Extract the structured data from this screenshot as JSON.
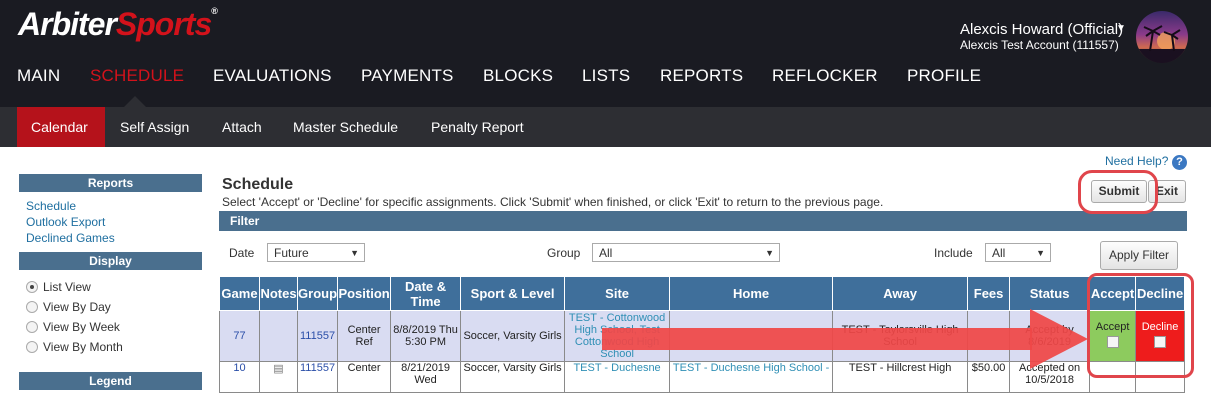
{
  "brand": {
    "name_part1": "Arbiter",
    "name_part2": "Sports",
    "tm": "®"
  },
  "user": {
    "name": "Alexcis Howard (Official)",
    "account": "Alexcis Test Account (111557)"
  },
  "main_nav": [
    {
      "label": "MAIN"
    },
    {
      "label": "SCHEDULE"
    },
    {
      "label": "EVALUATIONS"
    },
    {
      "label": "PAYMENTS"
    },
    {
      "label": "BLOCKS"
    },
    {
      "label": "LISTS"
    },
    {
      "label": "REPORTS"
    },
    {
      "label": "REFLOCKER"
    },
    {
      "label": "PROFILE"
    }
  ],
  "sub_nav": [
    {
      "label": "Calendar"
    },
    {
      "label": "Self Assign"
    },
    {
      "label": "Attach"
    },
    {
      "label": "Master Schedule"
    },
    {
      "label": "Penalty Report"
    }
  ],
  "sidebar": {
    "reports_header": "Reports",
    "report_links": [
      "Schedule",
      "Outlook Export",
      "Declined Games"
    ],
    "display_header": "Display",
    "display_options": [
      {
        "label": "List View",
        "selected": true
      },
      {
        "label": "View By Day",
        "selected": false
      },
      {
        "label": "View By Week",
        "selected": false
      },
      {
        "label": "View By Month",
        "selected": false
      }
    ],
    "legend_header": "Legend"
  },
  "help": {
    "label": "Need Help?",
    "icon": "?"
  },
  "page": {
    "title": "Schedule",
    "instruction": "Select 'Accept' or 'Decline' for specific assignments. Click 'Submit' when finished, or click 'Exit' to return to the previous page.",
    "submit_label": "Submit",
    "exit_label": "Exit"
  },
  "filter": {
    "header": "Filter",
    "date_label": "Date",
    "date_value": "Future",
    "group_label": "Group",
    "group_value": "All",
    "include_label": "Include",
    "include_value": "All",
    "apply_label": "Apply Filter"
  },
  "table": {
    "headers": [
      "Game",
      "Notes",
      "Group",
      "Position",
      "Date & Time",
      "Sport & Level",
      "Site",
      "Home",
      "Away",
      "Fees",
      "Status",
      "Accept",
      "Decline"
    ],
    "rows": [
      {
        "game": "77",
        "notes": "",
        "group": "111557",
        "position": "Center Ref",
        "datetime": "8/8/2019 Thu 5:30 PM",
        "sport": "Soccer, Varsity Girls",
        "site": "TEST - Cottonwood High School, Test Cottonwood High School",
        "home": "",
        "away": "TEST - Taylorsville High School",
        "fees": "",
        "status": "Accept by 8/6/2019",
        "accept": "Accept",
        "decline": "Decline"
      },
      {
        "game": "10",
        "notes": "",
        "group": "111557",
        "position": "Center",
        "datetime": "8/21/2019 Wed",
        "sport": "Soccer, Varsity Girls",
        "site": "TEST - Duchesne",
        "home": "TEST - Duchesne High School -",
        "away": "TEST - Hillcrest High",
        "fees": "$50.00",
        "status": "Accepted on 10/5/2018",
        "accept": "",
        "decline": ""
      }
    ]
  },
  "colors": {
    "topbar": "#1a1b22",
    "subnav": "#2d2e33",
    "brand_red": "#d3121b",
    "header_blue": "#3f6f9b",
    "accept_green": "#8dcb5e",
    "decline_red": "#ee1c1c",
    "annotation_red": "#e0454b"
  }
}
